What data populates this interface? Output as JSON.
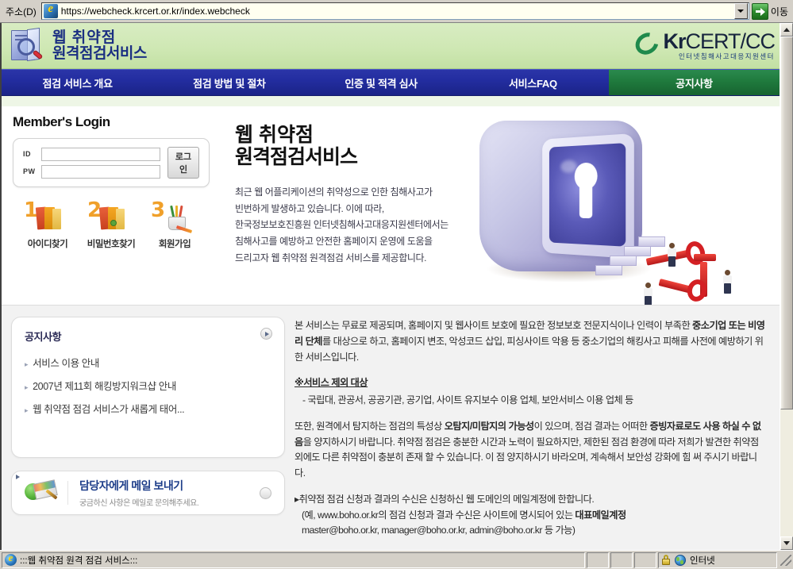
{
  "browser": {
    "address_label": "주소(D)",
    "url": "https://webcheck.krcert.or.kr/index.webcheck",
    "go_label": "이동",
    "status_text": ":::웹 취약점 원격 점검 서비스:::",
    "zone_label": "인터넷"
  },
  "header": {
    "brand_line1": "웹 취약점",
    "brand_line2": "원격점검서비스",
    "cert_logo_main_a": "Kr",
    "cert_logo_main_b": "CERT/CC",
    "cert_logo_sub": "인터넷침해사고대응지원센터"
  },
  "nav": {
    "items": [
      {
        "label": "점검 서비스 개요",
        "active": false
      },
      {
        "label": "점검 방법 및 절차",
        "active": false
      },
      {
        "label": "인증 및 적격 심사",
        "active": false
      },
      {
        "label": "서비스FAQ",
        "active": false
      },
      {
        "label": "공지사항",
        "active": true
      }
    ],
    "active_color": "#1f7a3d",
    "bar_color": "#232da0"
  },
  "login": {
    "title": "Member's Login",
    "id_label": "ID",
    "pw_label": "PW",
    "id_value": "",
    "pw_value": "",
    "button_label": "로그인"
  },
  "helper_links": [
    {
      "num": "1",
      "label": "아이디찾기",
      "icon": "books-icon"
    },
    {
      "num": "2",
      "label": "비밀번호찾기",
      "icon": "books-lock-icon"
    },
    {
      "num": "3",
      "label": "회원가입",
      "icon": "pencil-cup-icon"
    }
  ],
  "hero": {
    "title_line1": "웹 취약점",
    "title_line2": "원격점검서비스",
    "desc_line1": "최근 웹 어플리케이션의 취약성으로 인한 침해사고가",
    "desc_line2": "빈번하게 발생하고 있습니다. 이에 따라,",
    "desc_line3": "한국정보보호진흥원 인터넷침해사고대응지원센터에서는",
    "desc_line4": "침해사고를 예방하고 안전한 홈페이지 운영에 도움을",
    "desc_line5": "드리고자  웹 취약점 원격점검 서비스를 제공합니다.",
    "illustration": "monitor-keyhole-keys-illustration"
  },
  "notices": {
    "heading": "공지사항",
    "more_label": "more",
    "items": [
      "서비스 이용 안내",
      "2007년 제11회 해킹방지워크샵 안내",
      "웹 취약점 점검 서비스가 새롭게 태어..."
    ]
  },
  "mail_panel": {
    "title": "담당자에게 메일 보내기",
    "subtitle": "궁금하신 사항은 메일로 문의해주세요.",
    "icon": "mail-globe-icon"
  },
  "content": {
    "para1_a": "본 서비스는 무료로 제공되며, 홈페이지 및 웹사이트 보호에 필요한 정보보호 전문지식이나 인력이 부족한 ",
    "para1_b": "중소기업 또는 비영리 단체",
    "para1_c": "를 대상으로 하고, 홈페이지 변조, 악성코드 삽입, 피싱사이트 악용 등 중소기업의 해킹사고 피해를 사전에 예방하기 위한 서비스입니다.",
    "exclusion_heading": "※서비스 제외 대상",
    "exclusion_list": "- 국립대, 관공서, 공공기관, 공기업, 사이트 유지보수 이용 업체, 보안서비스 이용 업체 등",
    "para2_a": "또한, 원격에서 탐지하는 점검의 특성상 ",
    "para2_b": "오탐지/미탐지의 가능성",
    "para2_c": "이 있으며, 점검 결과는 어떠한 ",
    "para2_d": "증빙자료로도 사용 하실 수 없음",
    "para2_e": "을 양지하시기 바랍니다. 취약점 점검은 충분한 시간과 노력이 필요하지만, 제한된 점검 환경에 따라 저희가 발견한 취약점 외에도 다른 취약점이 충분히 존재 할 수 있습니다. 이 점 양지하시기 바라오며, 계속해서 보안성 강화에 힘 써 주시기 바랍니다.",
    "last_line1": "▸취약점 점검 신청과 결과의 수신은 신청하신 웹 도메인의 메일계정에 한합니다.",
    "last_line2_a": "(예, www.boho.or.kr의 점검 신청과 결과 수신은 사이트에 명시되어 있는 ",
    "last_line2_b": "대표메일계정",
    "last_line3": "master@boho.or.kr, manager@boho.or.kr, admin@boho.or.kr 등 가능)"
  }
}
